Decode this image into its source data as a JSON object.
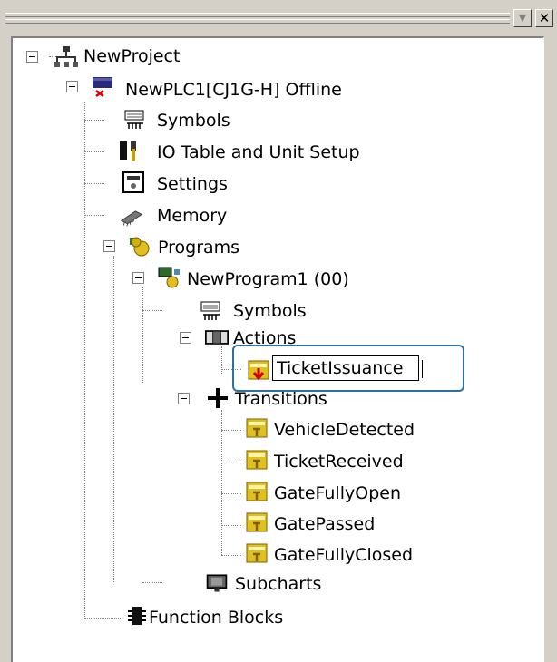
{
  "window": {
    "dropdown_glyph": "▼",
    "close_glyph": "✕"
  },
  "tree": {
    "project": "NewProject",
    "plc": "NewPLC1[CJ1G-H] Offline",
    "symbols": "Symbols",
    "io_table": "IO Table and Unit Setup",
    "settings": "Settings",
    "memory": "Memory",
    "programs": "Programs",
    "program1": "NewProgram1 (00)",
    "prog_symbols": "Symbols",
    "actions": "Actions",
    "action_edit_value": "TicketIssuance",
    "transitions": "Transitions",
    "transition_items": [
      "VehicleDetected",
      "TicketReceived",
      "GateFullyOpen",
      "GatePassed",
      "GateFullyClosed"
    ],
    "subcharts": "Subcharts",
    "function_blocks": "Function Blocks"
  }
}
